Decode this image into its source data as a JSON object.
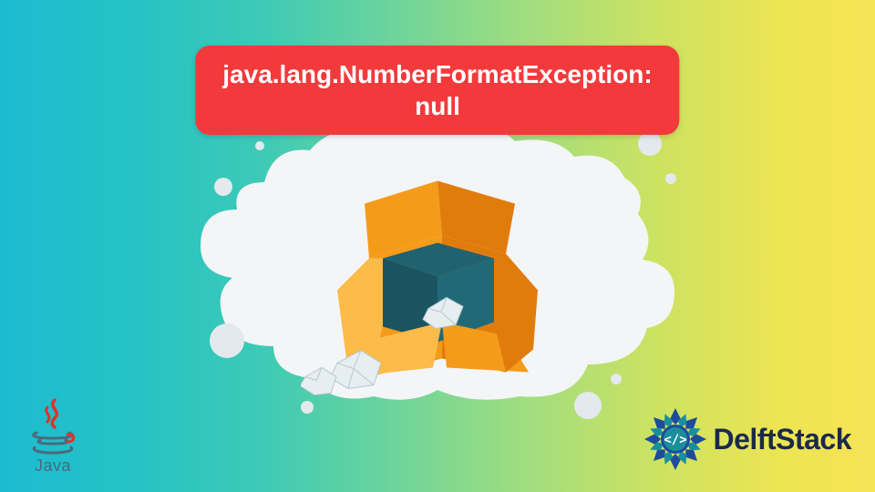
{
  "title": "java.lang.NumberFormatException:\nnull",
  "logos": {
    "java_label": "Java",
    "delft_label": "DelftStack"
  },
  "colors": {
    "badge_bg": "#f23a3c",
    "badge_fg": "#ffffff",
    "box_outer": "#f59b1a",
    "box_side": "#e07c0c",
    "box_inside": "#20626f",
    "paper": "#e7eef2",
    "blob": "#f3f5f7",
    "java_steam": "#e3302a",
    "java_cup": "#4a6a7a",
    "delft_blue": "#1f4b9e",
    "delft_teal": "#1a8f9c"
  }
}
